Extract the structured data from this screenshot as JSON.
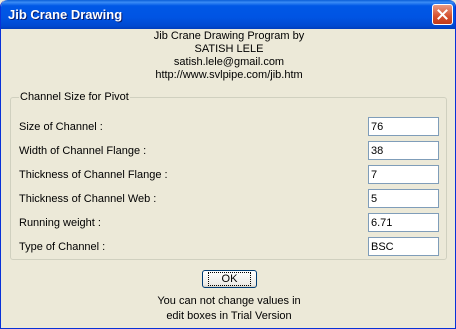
{
  "window": {
    "title": "Jib Crane Drawing"
  },
  "header": {
    "line1": "Jib Crane Drawing Program by",
    "line2": "SATISH LELE",
    "line3": "satish.lele@gmail.com",
    "line4": "http://www.svlpipe.com/jib.htm"
  },
  "group": {
    "legend": "Channel Size for Pivot",
    "rows": [
      {
        "label": "Size of Channel :",
        "value": "76"
      },
      {
        "label": "Width of Channel Flange :",
        "value": "38"
      },
      {
        "label": "Thickness of Channel Flange :",
        "value": "7"
      },
      {
        "label": "Thickness of Channel Web :",
        "value": "5"
      },
      {
        "label": "Running weight :",
        "value": "6.71"
      },
      {
        "label": "Type of Channel :",
        "value": "BSC"
      }
    ]
  },
  "ok_label": "OK",
  "footer": {
    "line1": "You can not change values in",
    "line2": "edit boxes in Trial Version"
  },
  "colors": {
    "titlebar": "#0054e3",
    "dialog_bg": "#ece9d8",
    "close_button": "#d5502e"
  },
  "icons": {
    "close": "close-icon"
  }
}
